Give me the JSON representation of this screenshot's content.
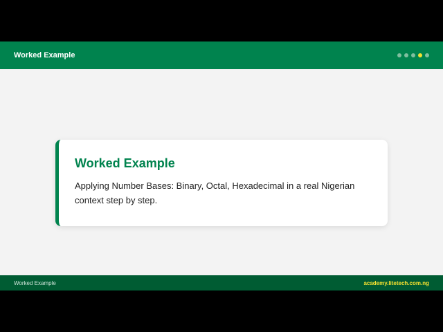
{
  "header": {
    "title": "Worked Example",
    "progress": {
      "total": 5,
      "current": 4
    }
  },
  "card": {
    "title": "Worked Example",
    "body": "Applying Number Bases: Binary, Octal, Hexadecimal in a real Nigerian context step by step."
  },
  "footer": {
    "left": "Worked Example",
    "right": "academy.litetech.com.ng"
  },
  "colors": {
    "brand_green": "#00834e",
    "footer_green": "#005c33",
    "accent_yellow": "#f5e130",
    "background": "#f3f3f3"
  }
}
